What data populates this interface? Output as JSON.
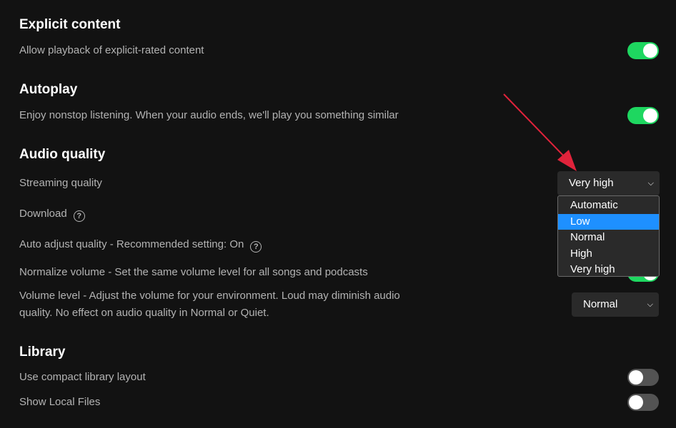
{
  "sections": {
    "explicit": {
      "title": "Explicit content",
      "allow_label": "Allow playback of explicit-rated content",
      "allow_on": true
    },
    "autoplay": {
      "title": "Autoplay",
      "desc": "Enjoy nonstop listening. When your audio ends, we'll play you something similar",
      "on": true
    },
    "audio_quality": {
      "title": "Audio quality",
      "streaming_label": "Streaming quality",
      "streaming_value": "Very high",
      "streaming_options": [
        "Automatic",
        "Low",
        "Normal",
        "High",
        "Very high"
      ],
      "highlighted_option": "Low",
      "download_label": "Download",
      "auto_adjust_label": "Auto adjust quality - Recommended setting: On",
      "normalize_label": "Normalize volume - Set the same volume level for all songs and podcasts",
      "normalize_on": true,
      "volume_level_label": "Volume level - Adjust the volume for your environment. Loud may diminish audio quality. No effect on audio quality in Normal or Quiet.",
      "volume_level_value": "Normal",
      "help_icon_glyph": "?"
    },
    "library": {
      "title": "Library",
      "compact_label": "Use compact library layout",
      "compact_on": false,
      "local_files_label": "Show Local Files",
      "local_files_on": false
    }
  },
  "icons": {
    "chevron": "chevron-down-icon",
    "help": "help-circle-icon",
    "annotation": "red-arrow-annotation"
  },
  "colors": {
    "background": "#121212",
    "toggle_on": "#1ed760",
    "toggle_off": "#535353",
    "dropdown_highlight": "#1e90ff",
    "annotation_arrow": "#e0233b"
  }
}
